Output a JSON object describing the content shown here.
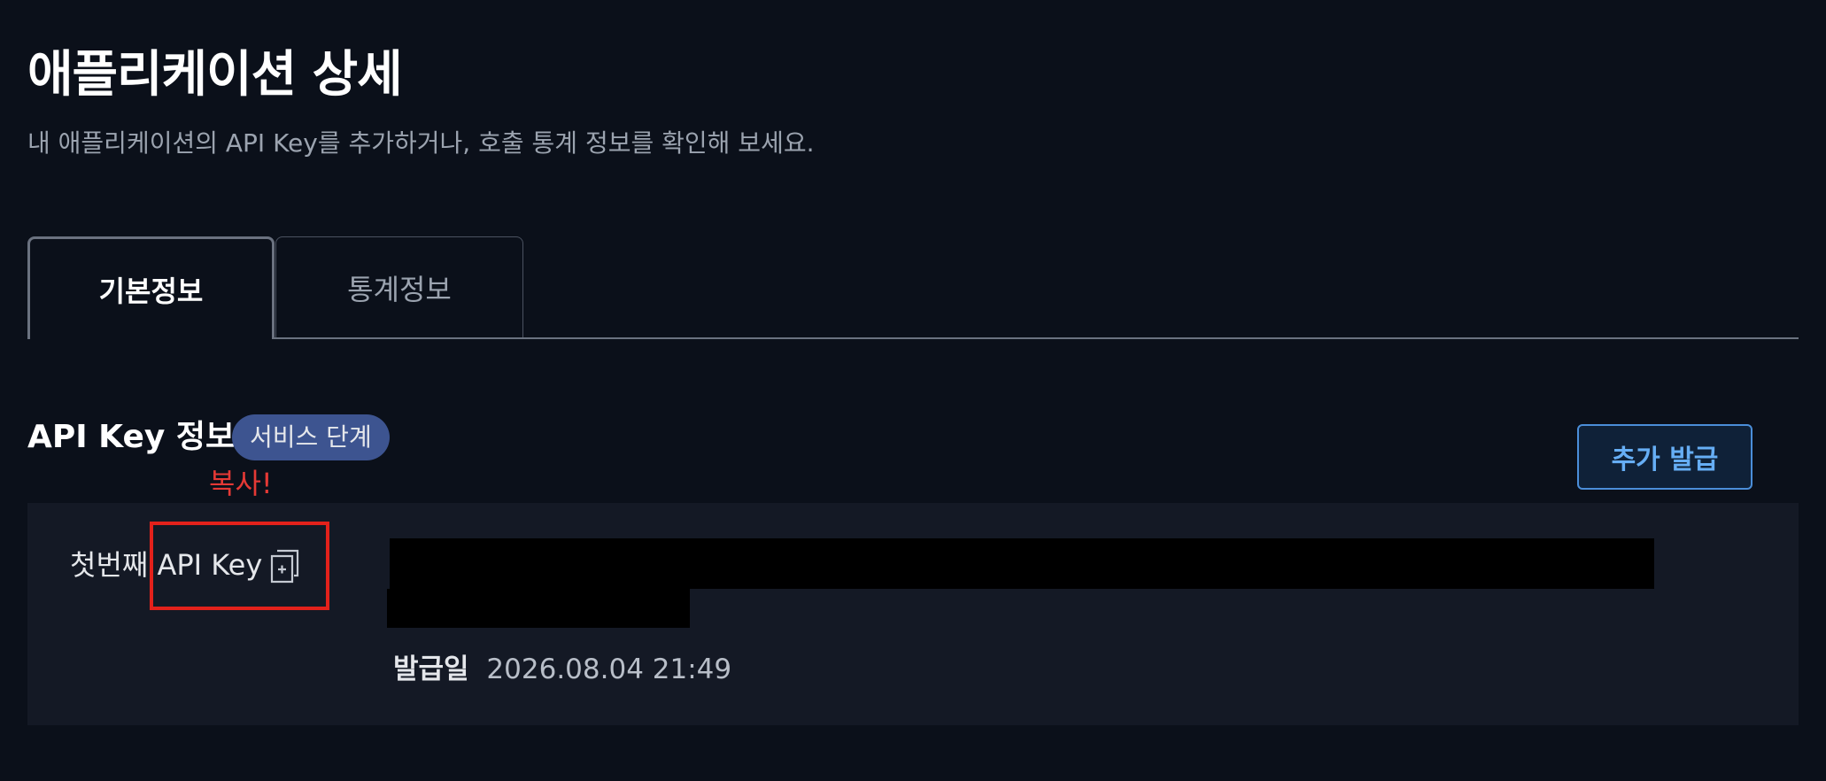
{
  "header": {
    "title": "애플리케이션 상세",
    "description": "내 애플리케이션의 API Key를 추가하거나, 호출 통계 정보를 확인해 보세요."
  },
  "tabs": [
    {
      "label": "기본정보",
      "active": true
    },
    {
      "label": "통계정보",
      "active": false
    }
  ],
  "api_key_section": {
    "title": "API Key 정보",
    "stage_badge": "서비스 단계",
    "add_button_label": "추가 발급",
    "copy_toast": "복사!",
    "keys": [
      {
        "label": "첫번째 API Key",
        "issued_label": "발급일",
        "issued_value": "2026.08.04 21:49"
      }
    ]
  },
  "icons": {
    "copy": "copy-icon"
  },
  "colors": {
    "background": "#0b101a",
    "card": "#141925",
    "badge": "#3d5490",
    "accent": "#66aef5",
    "toast": "#e53935",
    "highlight": "#e3211b"
  }
}
